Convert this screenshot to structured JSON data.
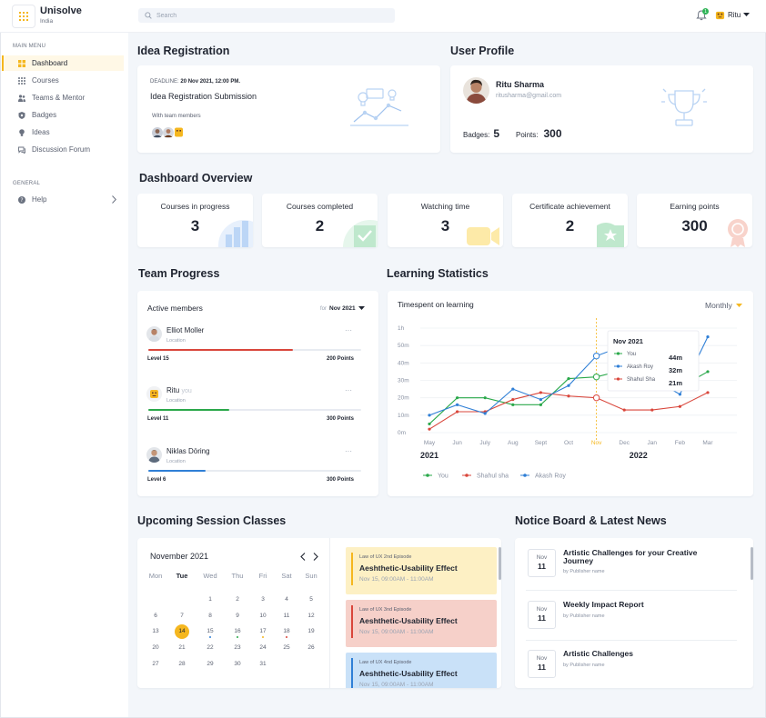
{
  "brand": {
    "name": "Unisolve",
    "sub": "India"
  },
  "search": {
    "placeholder": "Search"
  },
  "header": {
    "notification_count": "1",
    "user_name": "Ritu"
  },
  "sidebar": {
    "main_menu_label": "MAIN MENU",
    "items": [
      {
        "label": "Dashboard",
        "icon": "grid-icon",
        "active": true
      },
      {
        "label": "Courses",
        "icon": "courses-icon"
      },
      {
        "label": "Teams & Mentor",
        "icon": "team-icon"
      },
      {
        "label": "Badges",
        "icon": "badge-icon"
      },
      {
        "label": "Ideas",
        "icon": "bulb-icon"
      },
      {
        "label": "Discussion Forum",
        "icon": "forum-icon"
      }
    ],
    "general_label": "GENERAL",
    "help_label": "Help"
  },
  "idea": {
    "section_title": "Idea Registration",
    "deadline_label": "DEADLINE:",
    "deadline_value": "20 Nov 2021, 12:00 PM.",
    "title": "Idea Registration Submission",
    "team_label": "With team members"
  },
  "profile": {
    "section_title": "User Profile",
    "name": "Ritu Sharma",
    "email": "ritusharma@gmail.com",
    "badges_label": "Badges:",
    "badges_value": "5",
    "points_label": "Points:",
    "points_value": "300"
  },
  "overview": {
    "section_title": "Dashboard Overview",
    "stats": [
      {
        "label": "Courses in progress",
        "value": "3",
        "icon": "bar-chart-icon",
        "color": "#dbe8fb"
      },
      {
        "label": "Courses completed",
        "value": "2",
        "icon": "check-shield-icon",
        "color": "#d9f2e1"
      },
      {
        "label": "Watching time",
        "value": "3",
        "icon": "video-icon",
        "color": "#fdf1c9"
      },
      {
        "label": "Certificate achievement",
        "value": "2",
        "icon": "star-shield-icon",
        "color": "#d9f2e1"
      },
      {
        "label": "Earning points",
        "value": "300",
        "icon": "medal-icon",
        "color": "#fbe1dc"
      }
    ]
  },
  "team": {
    "section_title": "Team Progress",
    "active_label": "Active members",
    "for_label": "for",
    "month": "Nov 2021",
    "members": [
      {
        "name": "Elliot Moller",
        "you": "",
        "location": "Location",
        "level": "Level 15",
        "points": "200 Points",
        "progress": 0.68,
        "color": "#d9463b"
      },
      {
        "name": "Ritu",
        "you": "you",
        "location": "Location",
        "level": "Level 11",
        "points": "300 Points",
        "progress": 0.38,
        "color": "#2aa84a"
      },
      {
        "name": "Niklas Döring",
        "you": "",
        "location": "Location",
        "level": "Level 6",
        "points": "300 Points",
        "progress": 0.27,
        "color": "#2f7fd6"
      }
    ]
  },
  "stats_section": {
    "section_title": "Learning Statistics",
    "chart_title": "Timespent on learning",
    "period": "Monthly"
  },
  "chart_data": {
    "type": "line",
    "title": "Timespent on learning",
    "categories": [
      "May",
      "Jun",
      "July",
      "Aug",
      "Sept",
      "Oct",
      "Nov",
      "Dec",
      "Jan",
      "Feb",
      "Mar"
    ],
    "year_labels": [
      "2021",
      "2022"
    ],
    "y_ticks": [
      "0m",
      "10m",
      "20m",
      "30m",
      "40m",
      "50m",
      "1h"
    ],
    "ylim": [
      0,
      60
    ],
    "grid": true,
    "legend_position": "bottom-left",
    "highlight_category": "Nov",
    "series": [
      {
        "name": "You",
        "color": "#2aa84a",
        "values": [
          5,
          20,
          20,
          16,
          16,
          31,
          32,
          36,
          38,
          26,
          35
        ]
      },
      {
        "name": "Shahul sha",
        "color": "#d9463b",
        "values": [
          2,
          12,
          12,
          19,
          23,
          21,
          20,
          13,
          13,
          15,
          23
        ]
      },
      {
        "name": "Akash Roy",
        "color": "#2f7fd6",
        "values": [
          10,
          16,
          11,
          25,
          19,
          27,
          44,
          50,
          31,
          22,
          55
        ]
      }
    ],
    "tooltip": {
      "title": "Nov 2021",
      "rows": [
        {
          "name": "You",
          "value": "44m",
          "color": "#2aa84a"
        },
        {
          "name": "Akash Roy",
          "value": "32m",
          "color": "#2f7fd6"
        },
        {
          "name": "Shahul Sha",
          "value": "21m",
          "color": "#d9463b"
        }
      ]
    }
  },
  "sessions": {
    "section_title": "Upcoming Session Classes",
    "month": "November 2021",
    "weekdays": [
      "Mon",
      "Tue",
      "Wed",
      "Thu",
      "Fri",
      "Sat",
      "Sun"
    ],
    "weeks": [
      [
        "",
        "",
        "1",
        "2",
        "3",
        "4",
        "5"
      ],
      [
        "6",
        "7",
        "8",
        "9",
        "10",
        "11",
        "12"
      ],
      [
        "13",
        "14",
        "15",
        "16",
        "17",
        "18",
        "19"
      ],
      [
        "20",
        "21",
        "22",
        "23",
        "24",
        "25",
        "26"
      ],
      [
        "27",
        "28",
        "29",
        "30",
        "31",
        "",
        ""
      ]
    ],
    "selected_day": "14",
    "items": [
      {
        "episode": "Law of UX 2nd Episode",
        "title": "Aeshthetic-Usability Effect",
        "time": "Nov 15, 09:00AM - 11:00AM",
        "bg": "#fdf0c4",
        "bar": "#f5b71f"
      },
      {
        "episode": "Law of UX 3nd Episode",
        "title": "Aeshthetic-Usability Effect",
        "time": "Nov 15, 09:00AM - 11:00AM",
        "bg": "#f6d0c9",
        "bar": "#d9463b"
      },
      {
        "episode": "Law of UX 4nd Episode",
        "title": "Aeshthetic-Usability Effect",
        "time": "Nov 15, 09:00AM - 11:00AM",
        "bg": "#c9e1f8",
        "bar": "#2f7fd6"
      }
    ]
  },
  "notices": {
    "section_title": "Notice Board & Latest News",
    "items": [
      {
        "month": "Nov",
        "day": "11",
        "title": "Artistic Challenges for your Creative Journey",
        "publisher": "by Publisher name"
      },
      {
        "month": "Nov",
        "day": "11",
        "title": "Weekly Impact Report",
        "publisher": "by Publisher name"
      },
      {
        "month": "Nov",
        "day": "11",
        "title": "Artistic Challenges",
        "publisher": "by Publisher name"
      }
    ]
  }
}
